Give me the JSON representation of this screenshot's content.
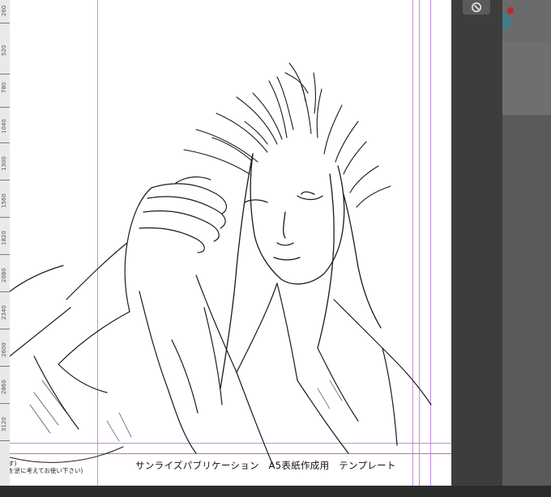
{
  "ruler": {
    "labels": [
      "260",
      "520",
      "780",
      "1040",
      "1300",
      "1560",
      "1820",
      "2080",
      "2340",
      "2600",
      "2860",
      "3120"
    ]
  },
  "canvas": {
    "template_label": "サンライズパブリケーション　A5表紙作成用　テンプレート",
    "note_lines": [
      "す)",
      "を逆に考えてお使い下さい)"
    ]
  },
  "toolbar": {
    "navigator_icon": "navigator-icon"
  },
  "colors": {
    "guide": "#c98be0",
    "bleed_guide": "#e06a7a",
    "accent_dot": "#c0262e",
    "panel_bg": "#3d3d3d"
  }
}
